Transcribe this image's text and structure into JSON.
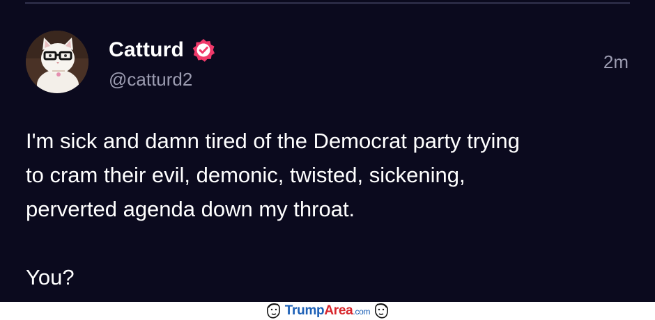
{
  "post": {
    "author": {
      "display_name": "Catturd",
      "handle": "@catturd2",
      "verified": true,
      "verified_badge_color": "#f0396a",
      "avatar_icon": "cat-with-glasses-avatar"
    },
    "timestamp": "2m",
    "text": {
      "line1": "I'm sick and damn tired of the Democrat party trying",
      "line2": "to cram their evil, demonic, twisted, sickening,",
      "line3": "perverted agenda down my throat.",
      "line4": "You?"
    }
  },
  "watermark": {
    "brand_part1": "Trump",
    "brand_part2": "Area",
    "brand_suffix": ".com",
    "brand_colors": {
      "primary": "#1b5fb6",
      "accent": "#d8262c"
    }
  },
  "theme": {
    "background": "#0b0a1e",
    "text_primary": "#ffffff",
    "text_secondary": "#9c9cb1",
    "divider": "#2a2a44"
  }
}
